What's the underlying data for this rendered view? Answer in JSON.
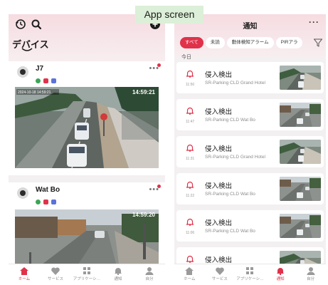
{
  "caption": "App screen",
  "left_screen": {
    "header": {
      "title": "デバイス"
    },
    "devices": [
      {
        "name": "J7",
        "timestamp": "14:59:21",
        "overlay_text": "2024-10-18 14:59:21"
      },
      {
        "name": "Wat Bo",
        "timestamp": "14:59:20"
      }
    ]
  },
  "right_screen": {
    "header": {
      "title": "通知"
    },
    "filters": [
      "すべて",
      "未読",
      "動体検知アラーム",
      "PIRアラ"
    ],
    "section_label": "今日",
    "alerts": [
      {
        "title": "侵入検出",
        "time": "11:50",
        "source": "SR-Parking CLD  Grand Hotel",
        "thumb": "a"
      },
      {
        "title": "侵入検出",
        "time": "11:47",
        "source": "SR-Parking CLD  Wat Bo",
        "thumb": "b"
      },
      {
        "title": "侵入検出",
        "time": "11:31",
        "source": "SR-Parking CLD  Grand Hotel",
        "thumb": "a"
      },
      {
        "title": "侵入検出",
        "time": "11:22",
        "source": "SR-Parking CLD  Wat Bo",
        "thumb": "b"
      },
      {
        "title": "侵入検出",
        "time": "11:06",
        "source": "SR-Parking CLD  Wat Bo",
        "thumb": "b"
      },
      {
        "title": "侵入検出",
        "time": "",
        "source": "",
        "thumb": "a"
      }
    ]
  },
  "bottom_nav": [
    {
      "label": "ホーム",
      "icon": "home-icon"
    },
    {
      "label": "サービス",
      "icon": "heart-icon"
    },
    {
      "label": "アプリケーシ…",
      "icon": "apps-icon"
    },
    {
      "label": "通知",
      "icon": "bell-icon"
    },
    {
      "label": "自分",
      "icon": "person-icon"
    }
  ],
  "colors": {
    "accent": "#e0324a",
    "header_pink": "#f6dce1",
    "background": "#f3f0f1"
  }
}
